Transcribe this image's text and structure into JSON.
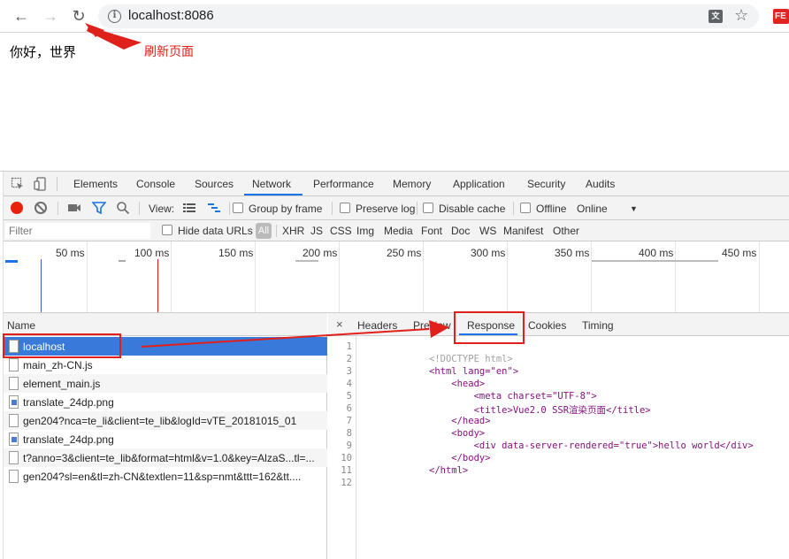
{
  "browser": {
    "url": "localhost:8086",
    "back_label": "←",
    "forward_label": "→",
    "reload_label": "↻",
    "info_glyph": "i",
    "translate_glyph": "文",
    "star_glyph": "☆",
    "ext_label": "FE"
  },
  "page": {
    "text": "你好，世界"
  },
  "annotation": {
    "text": "刷新页面",
    "color": "#e0201b"
  },
  "devtools": {
    "tabs": [
      "Elements",
      "Console",
      "Sources",
      "Network",
      "Performance",
      "Memory",
      "Application",
      "Security",
      "Audits"
    ],
    "active_tab": "Network",
    "toolbar": {
      "view_label": "View:",
      "group_by_frame": "Group by frame",
      "preserve_log": "Preserve log",
      "disable_cache": "Disable cache",
      "offline": "Offline",
      "throttle": "Online",
      "dropdown_glyph": "▼"
    },
    "filter": {
      "placeholder": "Filter",
      "hide_data_urls": "Hide data URLs",
      "all": "All",
      "types": [
        "XHR",
        "JS",
        "CSS",
        "Img",
        "Media",
        "Font",
        "Doc",
        "WS",
        "Manifest",
        "Other"
      ]
    },
    "timeline_ticks": [
      "50 ms",
      "100 ms",
      "150 ms",
      "200 ms",
      "250 ms",
      "300 ms",
      "350 ms",
      "400 ms",
      "450 ms"
    ],
    "name_header": "Name",
    "requests": [
      {
        "name": "localhost",
        "selected": true,
        "icon": "document-icon"
      },
      {
        "name": "main_zh-CN.js",
        "icon": "document-icon"
      },
      {
        "name": "element_main.js",
        "icon": "document-icon"
      },
      {
        "name": "translate_24dp.png",
        "icon": "image-icon"
      },
      {
        "name": "gen204?nca=te_li&client=te_lib&logId=vTE_20181015_01",
        "icon": "document-icon"
      },
      {
        "name": "translate_24dp.png",
        "icon": "image-icon"
      },
      {
        "name": "t?anno=3&client=te_lib&format=html&v=1.0&key=AlzaS...tl=...",
        "icon": "document-icon"
      },
      {
        "name": "gen204?sl=en&tl=zh-CN&textlen=11&sp=nmt&ttt=162&tt....",
        "icon": "document-icon"
      }
    ],
    "detail_tabs": [
      "Headers",
      "Preview",
      "Response",
      "Cookies",
      "Timing"
    ],
    "active_detail_tab": "Response",
    "close_glyph": "×",
    "response_lines": [
      "",
      "<!DOCTYPE html>",
      "<html lang=\"en\">",
      "    <head>",
      "        <meta charset=\"UTF-8\">",
      "        <title>Vue2.0 SSR渲染页面</title>",
      "    </head>",
      "    <body>",
      "        <div data-server-rendered=\"true\">hello world</div>",
      "    </body>",
      "</html>",
      ""
    ]
  }
}
